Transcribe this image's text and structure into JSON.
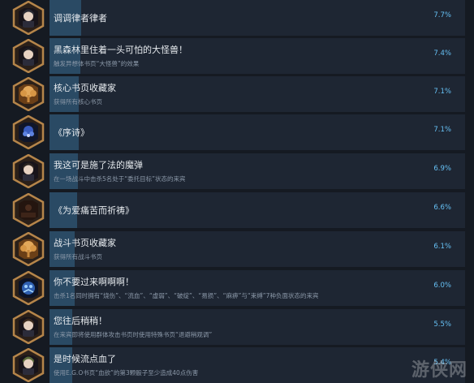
{
  "achievements": [
    {
      "title": "调调律者律者",
      "desc": "",
      "percent": "7.7%",
      "fill_fraction": 0.077,
      "icon": "character-portrait-icon"
    },
    {
      "title": "黑森林里住着一头可怕的大怪兽！",
      "desc": "触发异想体书页“大怪兽”的效果",
      "percent": "7.4%",
      "fill_fraction": 0.074,
      "icon": "character-portrait-icon"
    },
    {
      "title": "核心书页收藏家",
      "desc": "获得所有核心书页",
      "percent": "7.1%",
      "fill_fraction": 0.071,
      "icon": "golden-tree-emblem-icon"
    },
    {
      "title": "《序诗》",
      "desc": "",
      "percent": "7.1%",
      "fill_fraction": 0.071,
      "icon": "blue-flower-icon"
    },
    {
      "title": "我这可是施了法的魔弹",
      "desc": "在一场战斗中击杀5名处于“委托目标”状态的来宾",
      "percent": "6.9%",
      "fill_fraction": 0.069,
      "icon": "character-portrait-icon"
    },
    {
      "title": "《为爱痛苦而祈祷》",
      "desc": "",
      "percent": "6.6%",
      "fill_fraction": 0.066,
      "icon": "dark-scene-icon"
    },
    {
      "title": "战斗书页收藏家",
      "desc": "获得所有战斗书页",
      "percent": "6.1%",
      "fill_fraction": 0.061,
      "icon": "golden-tree-emblem-icon"
    },
    {
      "title": "你不要过来啊啊啊！",
      "desc": "击杀1名同时拥有“烧伤”、“流血”、“虚弱”、“破绽”、“易损”、“麻痹”与“束缚”7种负面状态的来宾",
      "percent": "6.0%",
      "fill_fraction": 0.06,
      "icon": "blue-monster-icon"
    },
    {
      "title": "您往后稍稍！",
      "desc": "在来宾即将使用群体攻击书页时使用特殊书页“退避稍观调”",
      "percent": "5.5%",
      "fill_fraction": 0.055,
      "icon": "character-portrait-icon"
    },
    {
      "title": "是时候流点血了",
      "desc": "使用E.G.O书页“血欲”的第3颗骰子至少造成40点伤害",
      "percent": "5.4%",
      "fill_fraction": 0.054,
      "icon": "character-portrait-icon"
    }
  ],
  "watermark": "游侠网",
  "colors": {
    "background": "#151a22",
    "row_bg": "#1e2633",
    "fill": "#2a4a64",
    "percent_text": "#66c0f4",
    "frame_gold": "#b5854a"
  }
}
